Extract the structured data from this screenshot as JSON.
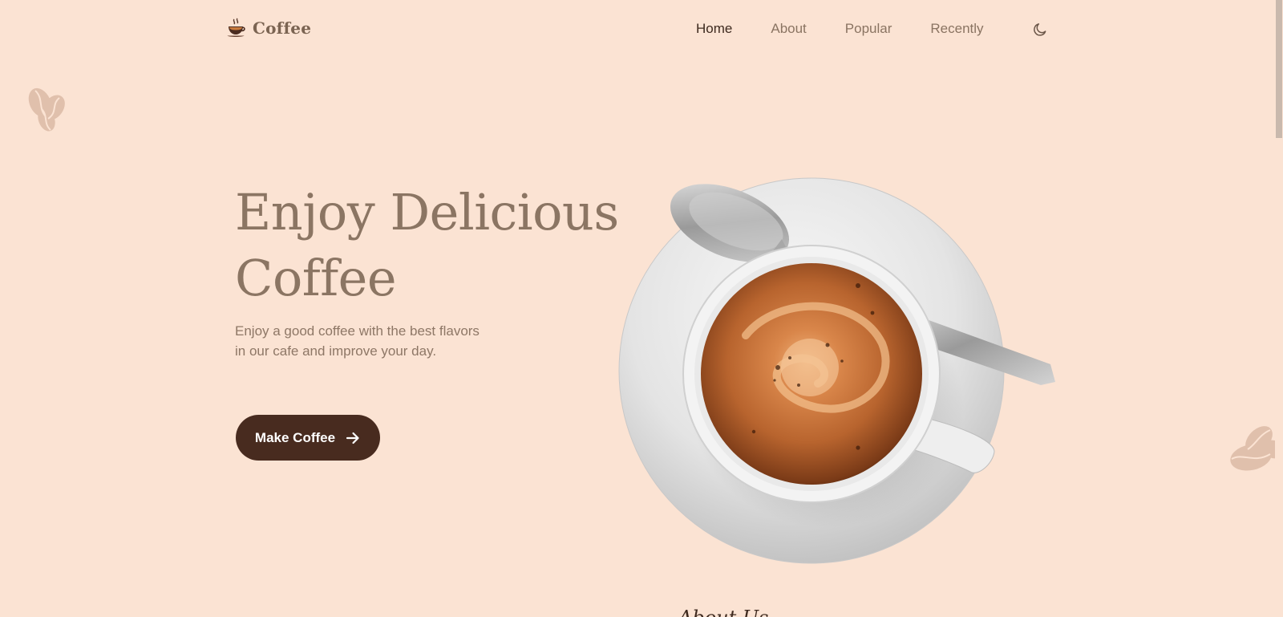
{
  "header": {
    "logo_text": "Coffee",
    "nav": [
      {
        "label": "Home",
        "active": true
      },
      {
        "label": "About",
        "active": false
      },
      {
        "label": "Popular",
        "active": false
      },
      {
        "label": "Recently",
        "active": false
      }
    ],
    "theme_icon": "moon-icon"
  },
  "hero": {
    "title_line1": "Enjoy Delicious",
    "title_line2": "Coffee",
    "description": "Enjoy a good coffee with the best flavors in our cafe and improve your day.",
    "cta_label": "Make Coffee",
    "cta_icon": "arrow-right-icon",
    "image": "coffee-cup-on-saucer-with-spoon"
  },
  "next_section": {
    "subtitle": "About Us"
  },
  "colors": {
    "background": "#fbe3d3",
    "title": "#8b7563",
    "text": "#8e7766",
    "button": "#482b1f",
    "active_nav": "#3e2a1f"
  }
}
